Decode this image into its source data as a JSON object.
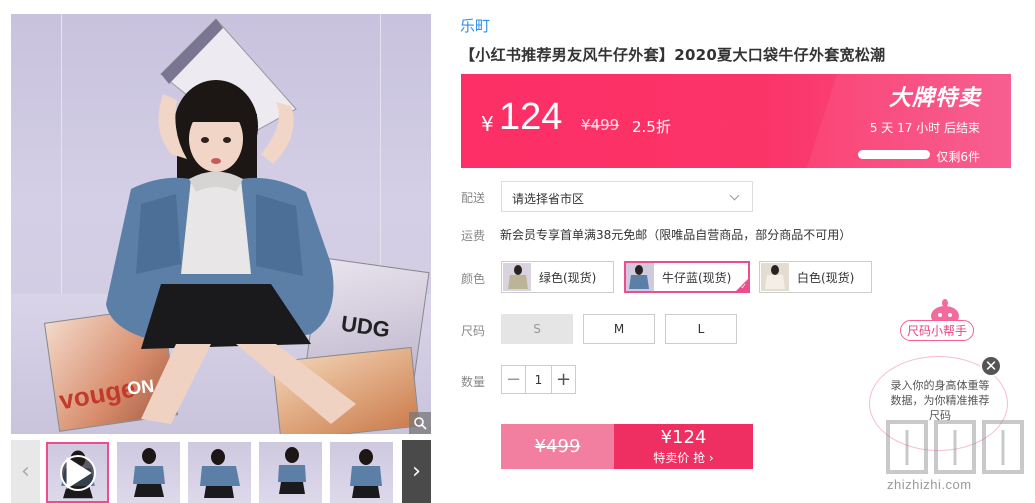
{
  "product": {
    "brand": "乐町",
    "title": "【小红书推荐男友风牛仔外套】2020夏大口袋牛仔外套宽松潮"
  },
  "price_box": {
    "currency": "¥",
    "price": "124",
    "original_price": "¥499",
    "discount": "2.5折",
    "flash_title": "大牌特卖",
    "countdown": "5 天 17 小时 后结束",
    "stock_text": "仅剩6件"
  },
  "shipping": {
    "label": "配送",
    "select_value": "请选择省市区",
    "fee_label": "运费",
    "fee_text": "新会员专享首单满38元免邮（限唯品自营商品，部分商品不可用）"
  },
  "color": {
    "label": "颜色",
    "options": [
      {
        "label": "绿色(现货)"
      },
      {
        "label": "牛仔蓝(现货)"
      },
      {
        "label": "白色(现货)"
      }
    ]
  },
  "size": {
    "label": "尺码",
    "options": [
      "S",
      "M",
      "L"
    ]
  },
  "quantity": {
    "label": "数量",
    "value": "1",
    "minus": "−",
    "plus": "+"
  },
  "buy": {
    "original_price": "¥499",
    "price": "¥124",
    "action_label": "特卖价 抢 ›"
  },
  "helper": {
    "tag": "尺码小帮手",
    "text": "录入你的身高体重等数据，为你精准推荐尺码",
    "close": "✕"
  },
  "gallery": {
    "magazine_words": [
      "vouge",
      "UDG",
      "ON 尼"
    ]
  },
  "watermark": {
    "text": "zhizhizhi.com"
  },
  "colors": {
    "accent": "#fd2f66",
    "brand_link": "#2e8ff0",
    "selected_border": "#ec4d8c"
  }
}
